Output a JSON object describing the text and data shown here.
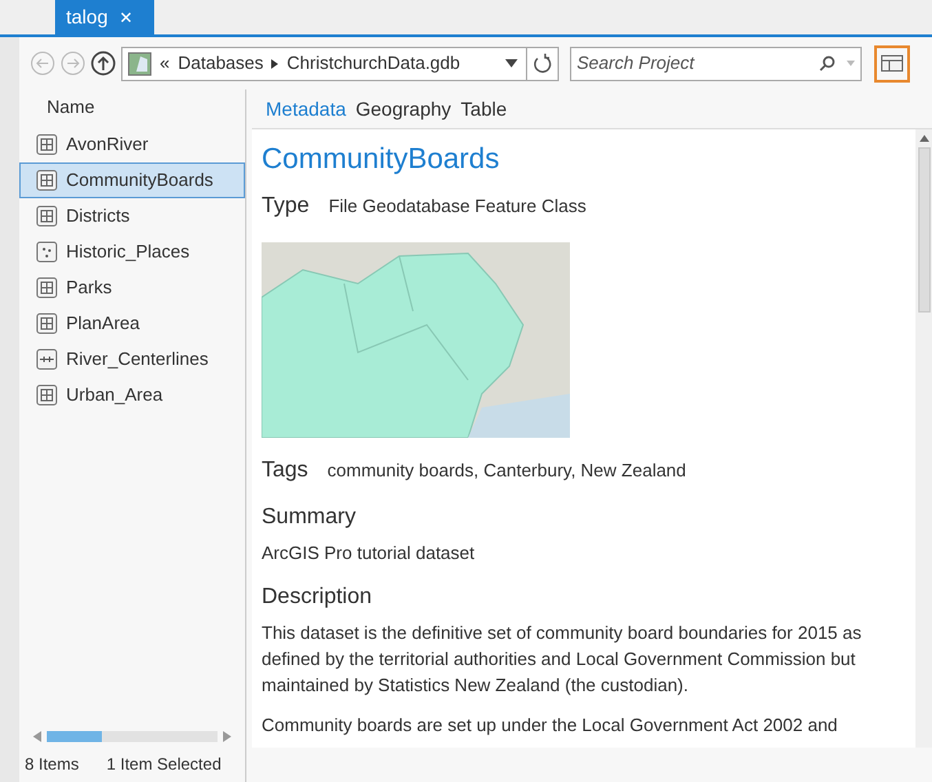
{
  "tab": {
    "label": "talog",
    "close": "✕"
  },
  "toolbar": {
    "breadcrumb": [
      {
        "label": "«"
      },
      {
        "label": "Databases"
      },
      {
        "label": "ChristchurchData.gdb"
      }
    ],
    "search": {
      "placeholder": "Search Project"
    }
  },
  "list": {
    "header": "Name",
    "items": [
      {
        "label": "AvonRiver",
        "kind": "polygon",
        "selected": false
      },
      {
        "label": "CommunityBoards",
        "kind": "polygon",
        "selected": true
      },
      {
        "label": "Districts",
        "kind": "polygon",
        "selected": false
      },
      {
        "label": "Historic_Places",
        "kind": "point",
        "selected": false
      },
      {
        "label": "Parks",
        "kind": "polygon",
        "selected": false
      },
      {
        "label": "PlanArea",
        "kind": "polygon",
        "selected": false
      },
      {
        "label": "River_Centerlines",
        "kind": "line",
        "selected": false
      },
      {
        "label": "Urban_Area",
        "kind": "polygon",
        "selected": false
      }
    ]
  },
  "view_tabs": [
    {
      "label": "Metadata",
      "selected": true
    },
    {
      "label": "Geography",
      "selected": false
    },
    {
      "label": "Table",
      "selected": false
    }
  ],
  "metadata": {
    "title": "CommunityBoards",
    "type_label": "Type",
    "type_value": "File Geodatabase Feature Class",
    "tags_label": "Tags",
    "tags_value": "community boards, Canterbury, New Zealand",
    "summary_label": "Summary",
    "summary": "ArcGIS Pro tutorial dataset",
    "description_label": "Description",
    "description": [
      "This dataset is the definitive set of community board boundaries for 2015 as defined by the territorial authorities and Local Government Commission but maintained by Statistics New Zealand (the custodian).",
      "Community boards are set up under the Local Government Act 2002 and"
    ]
  },
  "status_bar": {
    "count": "8 Items",
    "selection": "1 Item Selected"
  }
}
